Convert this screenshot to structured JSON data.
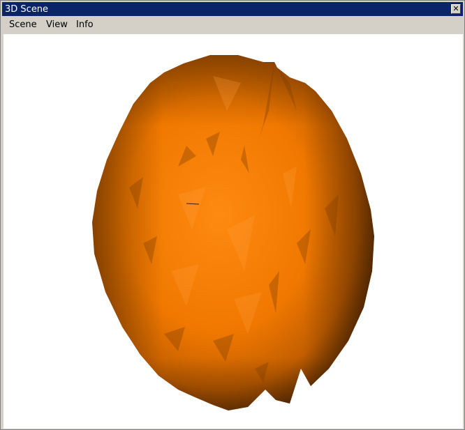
{
  "window": {
    "title": "3D Scene",
    "close_glyph": "✕"
  },
  "menu": {
    "items": [
      {
        "label": "Scene"
      },
      {
        "label": "View"
      },
      {
        "label": "Info"
      }
    ]
  },
  "viewport": {
    "background": "#ffffff",
    "object": "orange-rough-ellipsoid",
    "object_color": "#ff8000"
  }
}
